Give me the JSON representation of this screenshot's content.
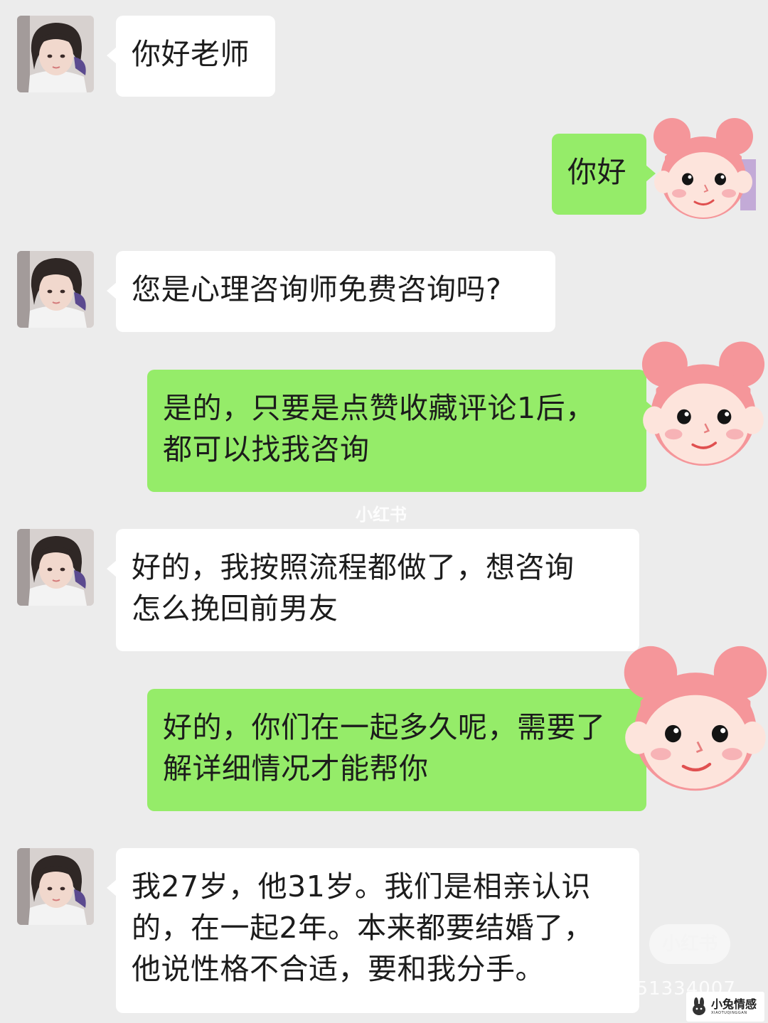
{
  "messages": [
    {
      "side": "incoming",
      "text": "你好老师"
    },
    {
      "side": "outgoing",
      "text": "你好"
    },
    {
      "side": "incoming",
      "text": "您是心理咨询师免费咨询吗?"
    },
    {
      "side": "outgoing",
      "text": "是的，只要是点赞收藏评论1后，\n都可以找我咨询"
    },
    {
      "side": "incoming",
      "text": "好的，我按照流程都做了，想咨询\n怎么挽回前男友"
    },
    {
      "side": "outgoing",
      "text": "好的，你们在一起多久呢，需要了\n解详细情况才能帮你"
    },
    {
      "side": "incoming",
      "text": "我27岁，他31岁。我们是相亲认识\n的，在一起2年。本来都要结婚了，\n他说性格不合适，要和我分手。"
    }
  ],
  "watermarks": {
    "center": "小红书",
    "pill": "小红书",
    "id_line": "小红书号：951334007",
    "brand_main": "小兔情感",
    "brand_sub": "XIAOTUQINGGAN"
  },
  "colors": {
    "background": "#ececec",
    "incoming_bubble": "#ffffff",
    "outgoing_bubble": "#95ec69",
    "sticker_skin": "#fde4dc",
    "sticker_hair": "#f5969a"
  },
  "icons": {
    "user_avatar": "girl-avatar-photo",
    "counselor_avatar": "pink-hair-girl-sticker",
    "brand_logo": "rabbit-logo"
  }
}
